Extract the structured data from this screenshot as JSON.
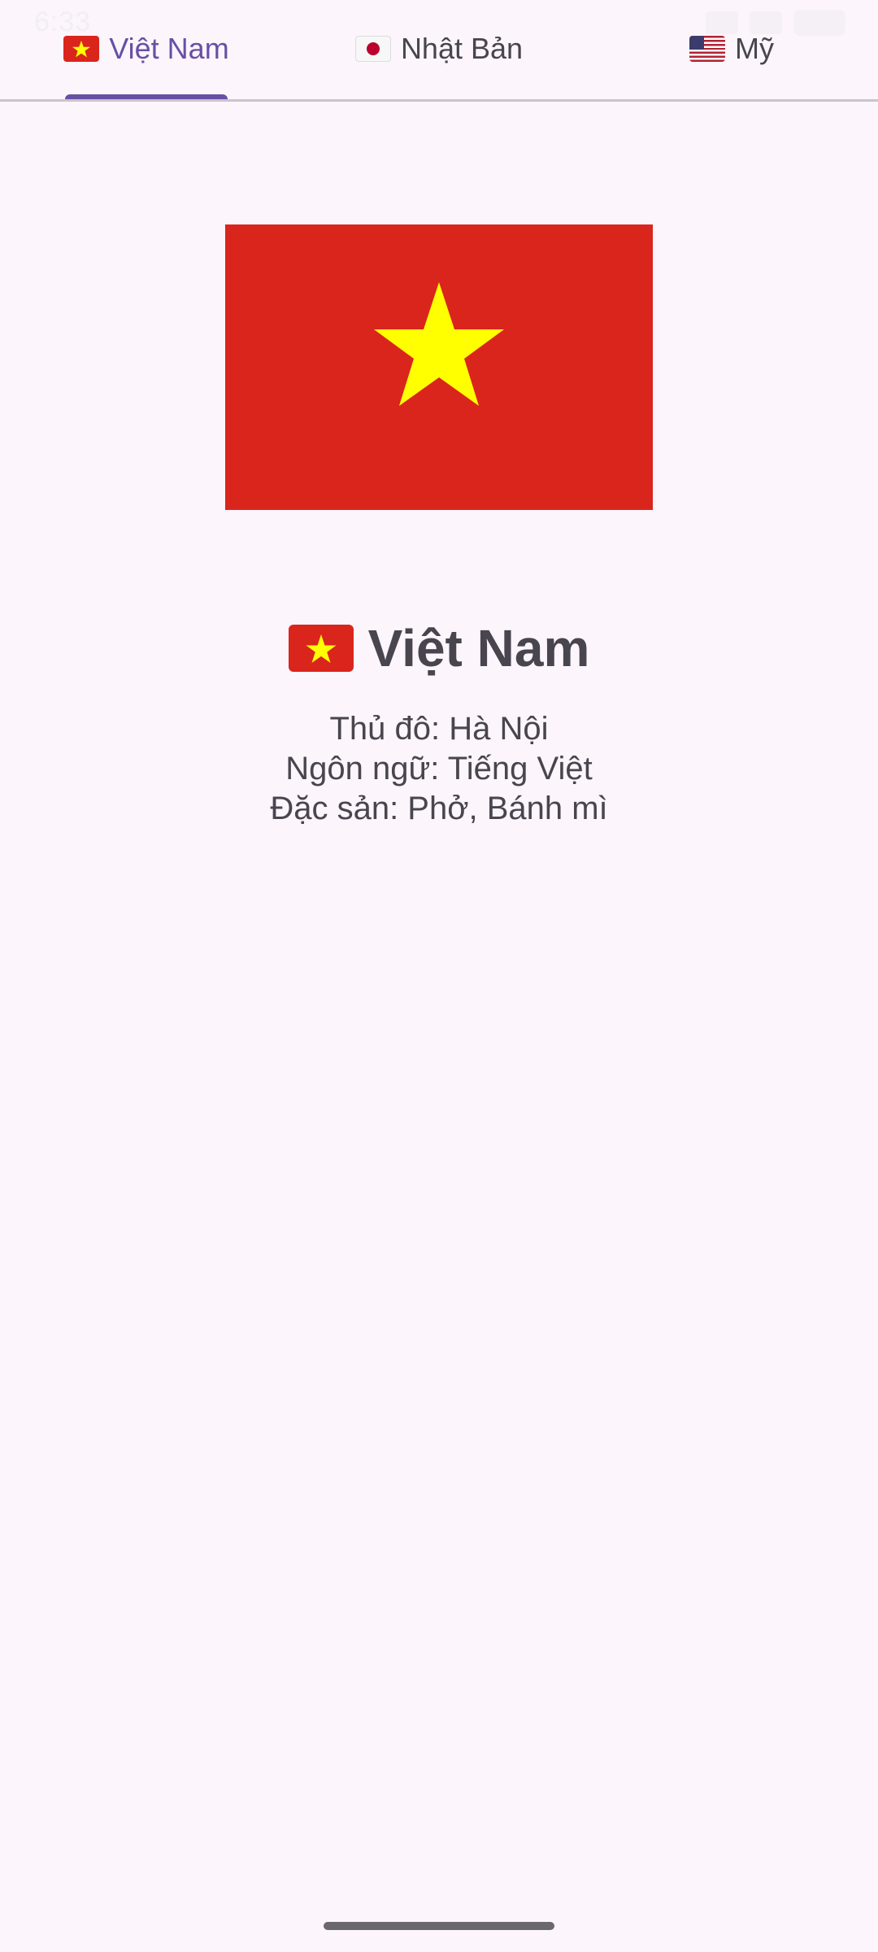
{
  "status_bar": {
    "time": "6:33"
  },
  "tabs": [
    {
      "flag_icon": "vietnam-flag-icon",
      "label": "Việt Nam",
      "active": true
    },
    {
      "flag_icon": "japan-flag-icon",
      "label": "Nhật Bản",
      "active": false
    },
    {
      "flag_icon": "usa-flag-icon",
      "label": "Mỹ",
      "active": false
    }
  ],
  "country": {
    "flag_icon": "vietnam-flag-icon",
    "name": "Việt Nam",
    "capital": "Thủ đô: Hà Nội",
    "language": "Ngôn ngữ: Tiếng Việt",
    "specialty": "Đặc sản: Phở, Bánh mì"
  },
  "colors": {
    "accent": "#6750a4",
    "background": "#fcf5fc",
    "text": "#49454f",
    "flag_red": "#da251d",
    "flag_yellow": "#ffff00"
  }
}
